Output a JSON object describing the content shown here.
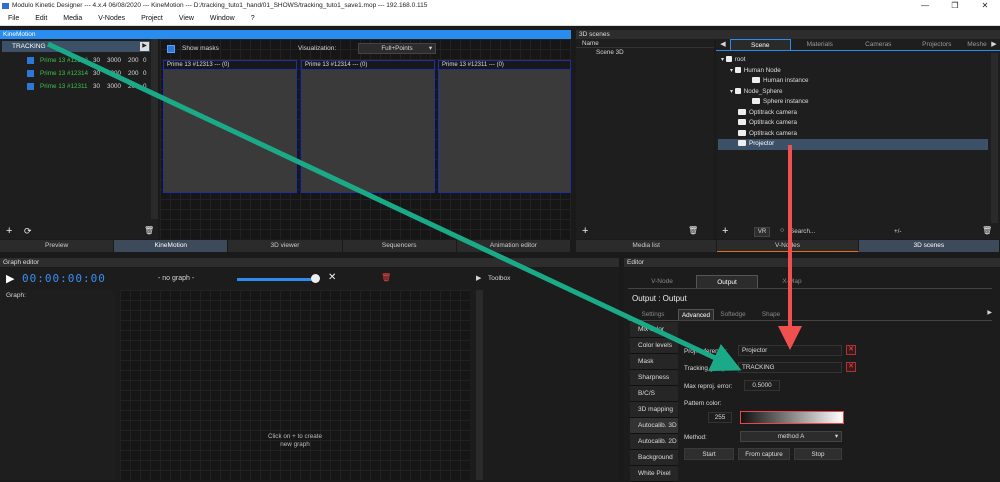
{
  "titlebar": {
    "title": "Modulo Kinetic Designer --- 4.x.4 06/08/2020 --- KineMotion --- D:/tracking_tuto1_hand/01_SHOWS/tracking_tuto1_save1.mop --- 192.168.0.115"
  },
  "menu": [
    "File",
    "Edit",
    "Media",
    "V-Nodes",
    "Project",
    "View",
    "Window",
    "?"
  ],
  "kinemotion": {
    "header": "KineMotion",
    "group": "TRACKING",
    "cameras": [
      {
        "name": "Prime 13 #12313",
        "c1": "30",
        "c2": "3000",
        "c3": "200",
        "c4": "0"
      },
      {
        "name": "Prime 13 #12314",
        "c1": "30",
        "c2": "3000",
        "c3": "200",
        "c4": "0"
      },
      {
        "name": "Prime 13 #12311",
        "c1": "30",
        "c2": "3000",
        "c3": "200",
        "c4": "0"
      }
    ],
    "show_masks": "Show masks",
    "visualization_label": "Visualization:",
    "visualization_value": "Full+Points",
    "views": [
      "Prime 13 #12313 --- (0)",
      "Prime 13 #12314 --- (0)",
      "Prime 13 #12311 --- (0)"
    ]
  },
  "bottom_tabs_left": [
    "Preview",
    "KineMotion",
    "3D viewer",
    "Sequencers",
    "Animation editor"
  ],
  "scenes": {
    "header": "3D scenes",
    "name_col": "Name",
    "scene_item": "Scene 3D",
    "tabs": [
      "Scene",
      "Materials",
      "Cameras",
      "Projectors",
      "Meshe"
    ],
    "tree": [
      {
        "label": "root",
        "indent": 0
      },
      {
        "label": "Human Node",
        "indent": 1
      },
      {
        "label": "Human instance",
        "indent": 2
      },
      {
        "label": "Node_Sphere",
        "indent": 1
      },
      {
        "label": "Sphere instance",
        "indent": 2
      },
      {
        "label": "Optitrack camera",
        "indent": 1
      },
      {
        "label": "Optitrack camera",
        "indent": 1
      },
      {
        "label": "Optitrack camera",
        "indent": 1
      },
      {
        "label": "Projector",
        "indent": 1
      }
    ],
    "vr_label": "VR",
    "search_placeholder": "Search...",
    "plusminus": "+/-"
  },
  "bottom_tabs_right": [
    "Media list",
    "V-Nodes",
    "3D scenes"
  ],
  "graph": {
    "header": "Graph editor",
    "timecode": "00:00:00:00",
    "no_graph": "- no graph -",
    "toolbox": "Toolbox",
    "graph_label": "Graph:",
    "hint_line1": "Click on + to create",
    "hint_line2": "new graph"
  },
  "editor": {
    "header": "Editor",
    "tabs": [
      "V-Node",
      "Output",
      "X-Map"
    ],
    "title": "Output : Output",
    "subtabs": [
      "Settings",
      "Advanced",
      "Softedge",
      "Shape"
    ],
    "sidebar": [
      "Mix color",
      "Color levels",
      "Mask",
      "Sharpness",
      "B/C/S",
      "3D mapping",
      "Autocalib. 3D",
      "Autocalib. 2D",
      "Background",
      "White Pixel"
    ],
    "proj_ref_label": "Proj. reference:",
    "proj_ref_value": "Projector",
    "tracking_group_label": "Tracking group:",
    "tracking_group_value": "TRACKING",
    "max_reproj_label": "Max reproj. error:",
    "max_reproj_value": "0.5000",
    "pattern_color_label": "Pattern color:",
    "pattern_color_value": "255",
    "method_label": "Method:",
    "method_value": "method A",
    "start": "Start",
    "from_capture": "From capture",
    "stop": "Stop"
  },
  "colors": {
    "accent": "#2b8cf0",
    "arrow_green": "#1aaa88",
    "arrow_red": "#f05050",
    "green_text": "#3cc24a"
  }
}
